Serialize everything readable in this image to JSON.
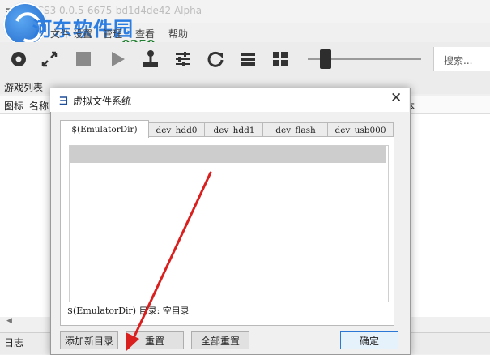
{
  "window": {
    "title": "RPCS3 0.0.5-6675-bd1d4de42 Alpha",
    "logo_text": "ヨ"
  },
  "watermark": {
    "line1": "河东软件园",
    "line2": "www.pc0359.cn"
  },
  "menu": {
    "items": [
      "文件",
      "设置",
      "管理",
      "查看",
      "帮助"
    ]
  },
  "toolbar": {
    "icons": [
      "disc-icon",
      "fullscreen-icon",
      "stop-icon",
      "play-icon",
      "joystick-icon",
      "sliders-icon",
      "refresh-icon",
      "list-view-icon",
      "grid-view-icon"
    ],
    "search_placeholder": "搜索..."
  },
  "game_list": {
    "title": "游戏列表",
    "columns": [
      "图标",
      "名称",
      "本"
    ]
  },
  "log": {
    "title": "日志"
  },
  "dialog": {
    "title": "虚拟文件系统",
    "tabs": [
      "$(EmulatorDir)",
      "dev_hdd0",
      "dev_hdd1",
      "dev_flash",
      "dev_usb000"
    ],
    "active_tab": 0,
    "status_text": "$(EmulatorDir) 目录: 空目录",
    "buttons": {
      "add_dir": "添加新目录",
      "reset": "重置",
      "reset_all": "全部重置",
      "ok": "确定"
    }
  },
  "colors": {
    "annotation": "#d9201f",
    "accent": "#2a77d5"
  }
}
